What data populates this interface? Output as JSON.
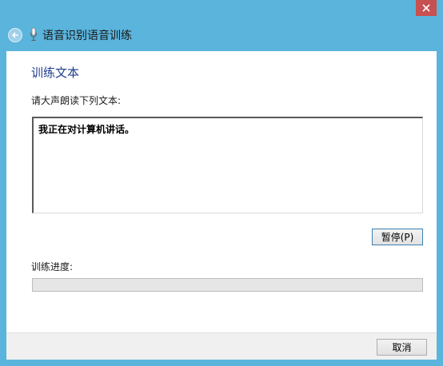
{
  "window": {
    "title": "语音识别语音训练",
    "accent_color": "#5ab4dc",
    "close_color": "#c75050"
  },
  "icons": {
    "back": "back-arrow-icon",
    "mic": "microphone-icon",
    "close": "close-icon"
  },
  "main": {
    "heading": "训练文本",
    "instruction": "请大声朗读下列文本:",
    "training_text": "我正在对计算机讲话。",
    "pause_label": "暂停(P)",
    "progress_label": "训练进度:",
    "progress_value": 0
  },
  "footer": {
    "cancel_label": "取消"
  }
}
